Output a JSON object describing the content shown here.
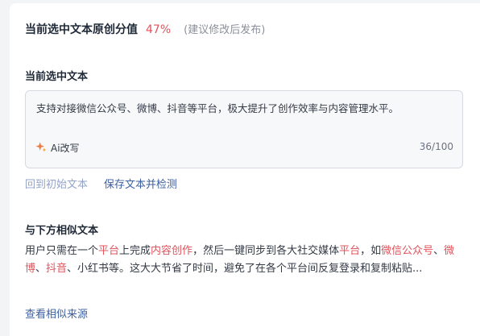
{
  "originality": {
    "label": "当前选中文本原创分值",
    "score": "47%",
    "hint": "(建议修改后发布)",
    "score_color": "#e0535b"
  },
  "selected": {
    "title": "当前选中文本",
    "text": "支持对接微信公众号、微博、抖音等平台，极大提升了创作效率与内容管理水平。",
    "ai_label": "Ai改写",
    "ai_icon": "sparkle-icon",
    "counter": "36/100"
  },
  "actions": {
    "reset_label": "回到初始文本",
    "save_label": "保存文本并检测"
  },
  "similar": {
    "title": "与下方相似文本",
    "segments": [
      {
        "text": "用户只需在一个",
        "hl": false
      },
      {
        "text": "平台",
        "hl": true
      },
      {
        "text": "上完成",
        "hl": false
      },
      {
        "text": "内容创作",
        "hl": true
      },
      {
        "text": "，然后一键同步到各大社交媒体",
        "hl": false
      },
      {
        "text": "平台",
        "hl": true
      },
      {
        "text": "，如",
        "hl": false
      },
      {
        "text": "微信公众号",
        "hl": true
      },
      {
        "text": "、",
        "hl": false
      },
      {
        "text": "微博",
        "hl": true
      },
      {
        "text": "、",
        "hl": false
      },
      {
        "text": "抖音",
        "hl": true
      },
      {
        "text": "、小红书等。这大大节省了时间，避免了在各个平台间反复登录和复制粘贴...",
        "hl": false
      }
    ],
    "view_source_label": "查看相似来源",
    "highlight_color": "#e0535b"
  }
}
